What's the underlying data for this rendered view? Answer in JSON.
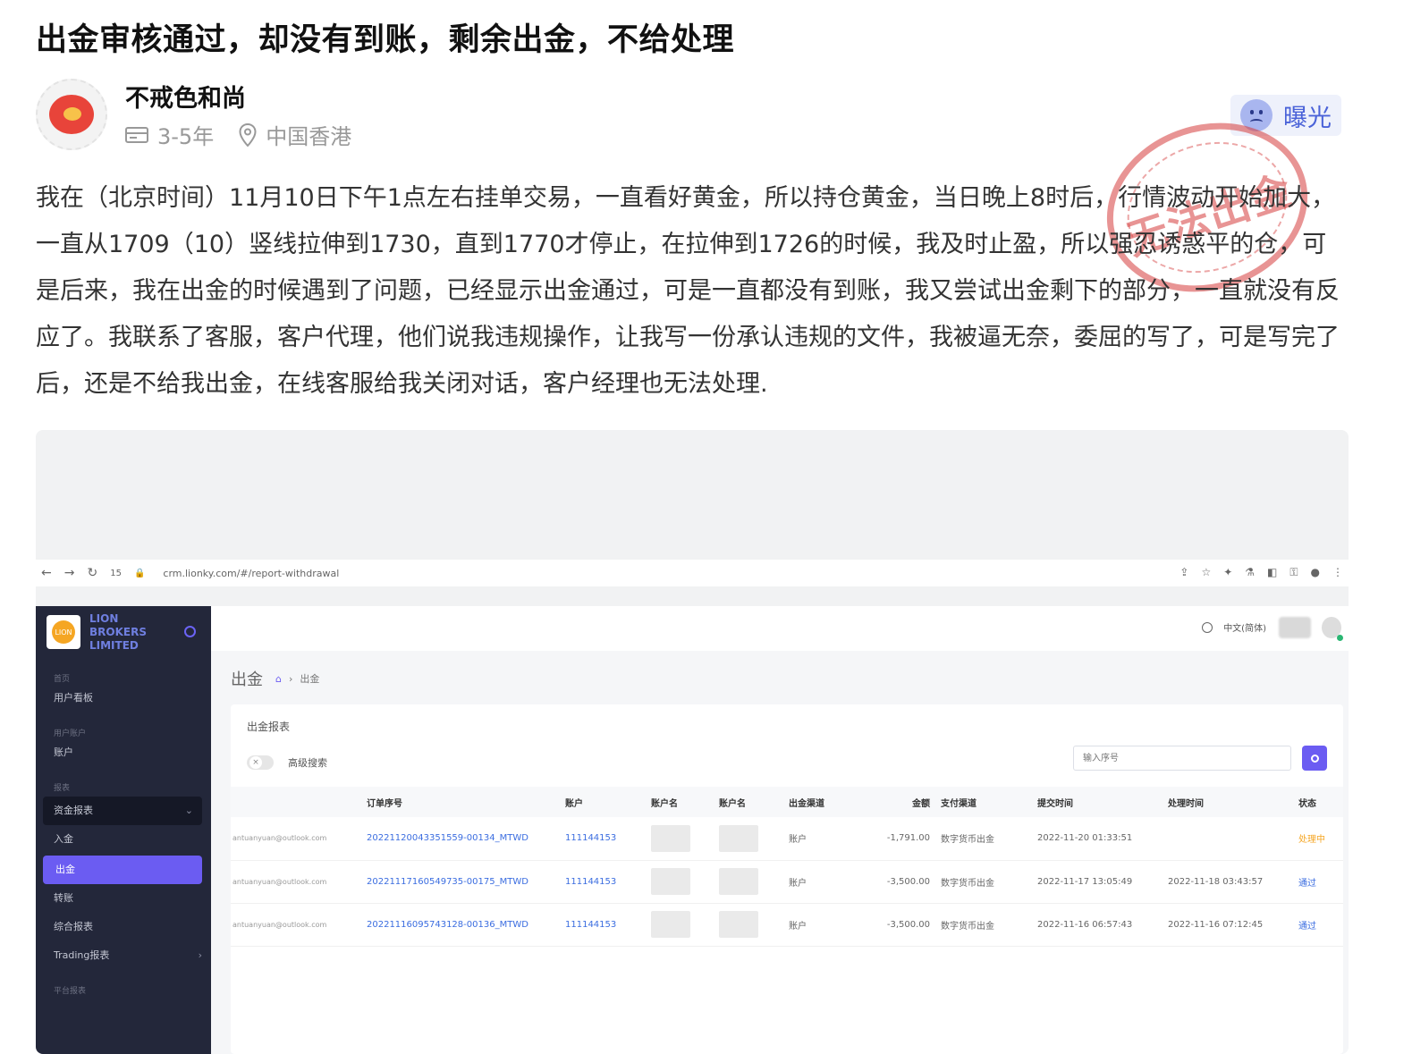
{
  "post": {
    "title": "出金审核通过，却没有到账，剩余出金，不给处理",
    "author": {
      "name": "不戒色和尚",
      "experience": "3-5年",
      "location": "中国香港"
    },
    "expose_label": "曝光",
    "stamp_text": "无法出金",
    "content": "我在（北京时间）11月10日下午1点左右挂单交易，一直看好黄金，所以持仓黄金，当日晚上8时后，行情波动开始加大，一直从1709（10）竖线拉伸到1730，直到1770才停止，在拉伸到1726的时候，我及时止盈，所以强忍诱惑平的仓，可是后来，我在出金的时候遇到了问题，已经显示出金通过，可是一直都没有到账，我又尝试出金剩下的部分，一直就没有反应了。我联系了客服，客户代理，他们说我违规操作，让我写一份承认违规的文件，我被逼无奈，委屈的写了，可是写完了后，还是不给我出金，在线客服给我关闭对话，客户经理也无法处理."
  },
  "screenshot": {
    "browser": {
      "url": "crm.lionky.com/#/report-withdrawal",
      "tab_count": "15"
    },
    "sidebar": {
      "logo_text": "LION BROKERS LIMITED",
      "logo_badge": "LION",
      "groups": [
        {
          "label": "首页",
          "items": [
            "用户看板"
          ]
        },
        {
          "label": "用户账户",
          "items": [
            "账户"
          ]
        },
        {
          "label": "报表",
          "items": [
            "资金报表",
            "入金",
            "出金",
            "转账",
            "综合报表",
            "Trading报表"
          ]
        }
      ],
      "open_item": "资金报表",
      "active_item": "出金",
      "footer_group": "平台报表"
    },
    "topbar": {
      "language": "中文(简体)"
    },
    "page": {
      "heading": "出金",
      "breadcrumb": "出金"
    },
    "card": {
      "title": "出金报表",
      "advanced_search": "高级搜索",
      "search_placeholder": "输入序号"
    },
    "table": {
      "headers": [
        "",
        "订单序号",
        "账户",
        "账户名",
        "账户名",
        "出金渠道",
        "金额",
        "支付渠道",
        "提交时间",
        "处理时间",
        "状态"
      ],
      "rows": [
        {
          "email": "antuanyuan@outlook.com",
          "order": "20221120043351559-00134_MTWD",
          "account": "111144153",
          "channel": "账户",
          "amount": "-1,791.00",
          "payment": "数字货币出金",
          "submitted": "2022-11-20 01:33:51",
          "processed": "",
          "status": "处理中",
          "status_type": "processing"
        },
        {
          "email": "antuanyuan@outlook.com",
          "order": "20221117160549735-00175_MTWD",
          "account": "111144153",
          "channel": "账户",
          "amount": "-3,500.00",
          "payment": "数字货币出金",
          "submitted": "2022-11-17 13:05:49",
          "processed": "2022-11-18 03:43:57",
          "status": "通过",
          "status_type": "pass"
        },
        {
          "email": "antuanyuan@outlook.com",
          "order": "20221116095743128-00136_MTWD",
          "account": "111144153",
          "channel": "账户",
          "amount": "-3,500.00",
          "payment": "数字货币出金",
          "submitted": "2022-11-16 06:57:43",
          "processed": "2022-11-16 07:12:45",
          "status": "通过",
          "status_type": "pass"
        }
      ]
    }
  },
  "colors": {
    "accent": "#6b5cf2",
    "link": "#3b6de0",
    "processing": "#f5a623",
    "stamp": "#d63c3c"
  }
}
